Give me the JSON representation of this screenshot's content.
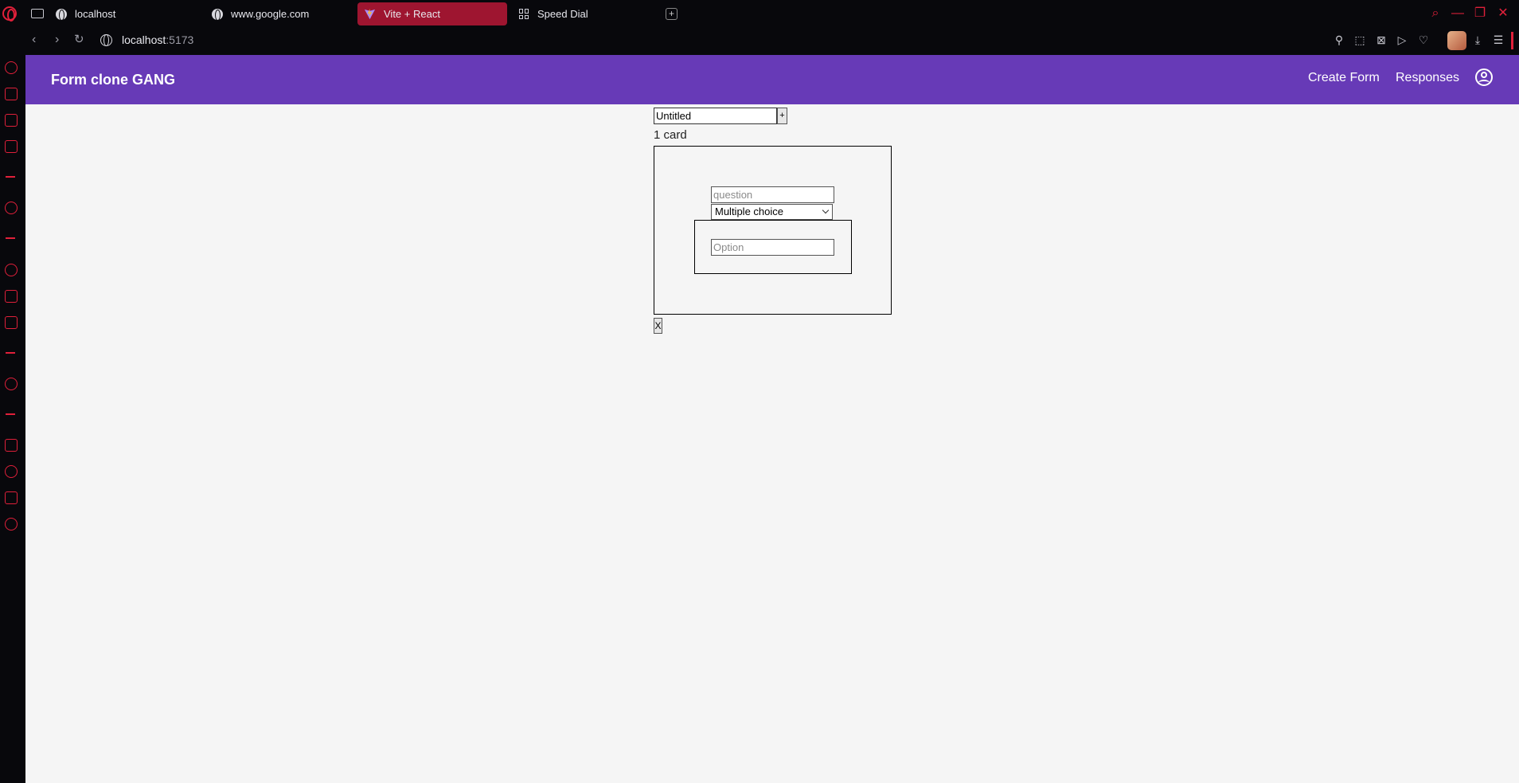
{
  "browser": {
    "tabs": [
      {
        "label": "localhost",
        "active": false
      },
      {
        "label": "www.google.com",
        "active": false
      },
      {
        "label": "Vite + React",
        "active": true
      },
      {
        "label": "Speed Dial",
        "active": false
      }
    ],
    "new_tab_label": "+",
    "address": {
      "host": "localhost",
      "port": ":5173"
    },
    "accent_color": "#e0203a"
  },
  "app": {
    "title": "Form clone GANG",
    "nav": {
      "create_form": "Create Form",
      "responses": "Responses"
    },
    "brand_color": "#673ab7"
  },
  "form": {
    "title_value": "Untitled",
    "add_label": "+",
    "card_count": "1 card",
    "question_placeholder": "question",
    "type_selected": "Multiple choice",
    "option_placeholder": "Option",
    "remove_label": "X"
  }
}
